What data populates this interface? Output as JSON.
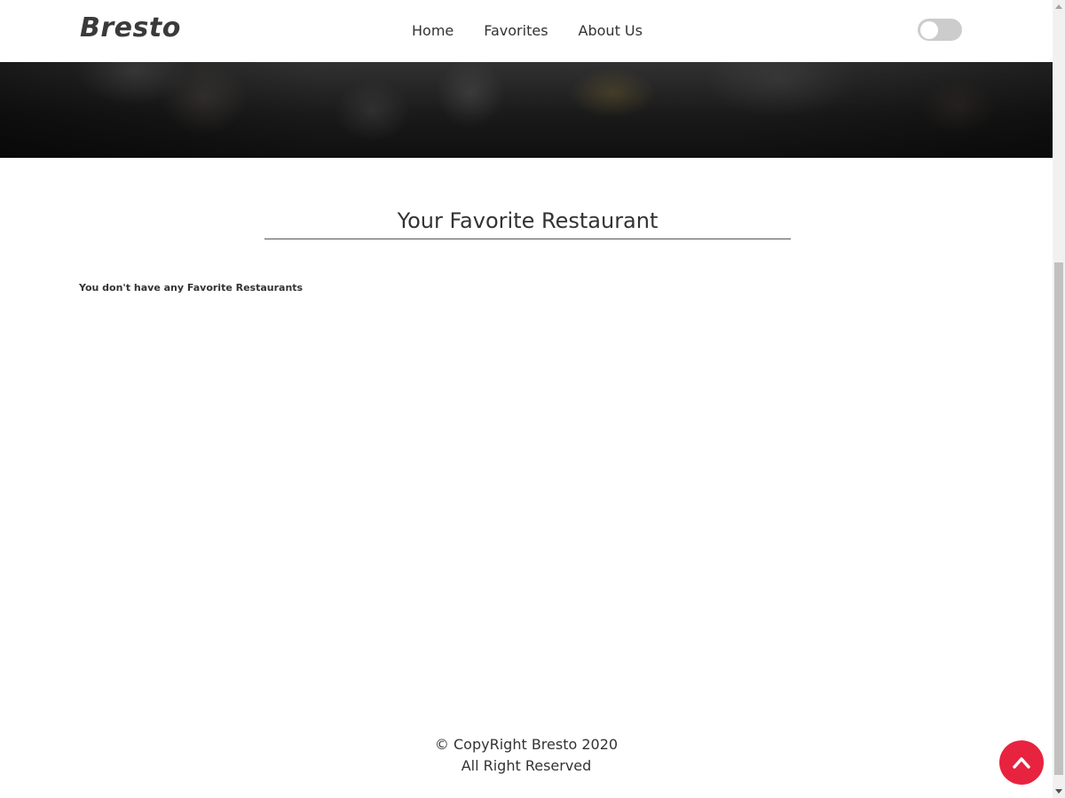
{
  "navbar": {
    "brand": "Bresto",
    "links": [
      {
        "label": "Home"
      },
      {
        "label": "Favorites"
      },
      {
        "label": "About Us"
      }
    ],
    "theme_toggle": {
      "state": "off"
    }
  },
  "main": {
    "title": "Your Favorite Restaurant",
    "empty_message": "You don't have any Favorite Restaurants"
  },
  "footer": {
    "line1": "© CopyRight Bresto 2020",
    "line2": "All Right Reserved"
  },
  "scroll_top_button": {
    "icon": "chevron-up-icon",
    "color": "#e8233f"
  },
  "colors": {
    "text": "#333333",
    "accent": "#e8233f",
    "toggle_track": "#cccccc"
  }
}
